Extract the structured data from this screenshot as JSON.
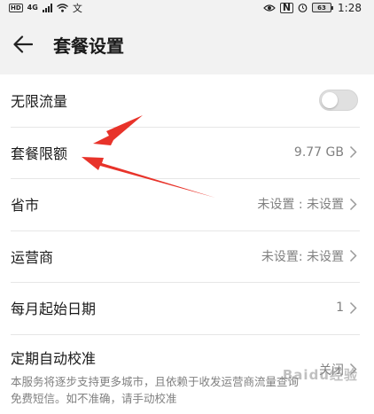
{
  "status_bar": {
    "hd": "HD",
    "network": "4G",
    "wifi_text": "文",
    "nfc": "N",
    "battery": "63",
    "time": "1:28"
  },
  "header": {
    "title": "套餐设置"
  },
  "settings": {
    "unlimited": {
      "label": "无限流量",
      "enabled": false
    },
    "quota": {
      "label": "套餐限额",
      "value": "9.77 GB"
    },
    "province": {
      "label": "省市",
      "value": "未设置 : 未设置"
    },
    "carrier": {
      "label": "运营商",
      "value": "未设置: 未设置"
    },
    "start_day": {
      "label": "每月起始日期",
      "value": "1"
    },
    "auto_calibrate": {
      "label": "定期自动校准",
      "description": "本服务将逐步支持更多城市，且依赖于收发运营商流量查询免费短信。如不准确，请手动校准",
      "value": "关闭"
    }
  },
  "colors": {
    "arrow": "#e8332a",
    "background": "#f2f2f2",
    "card": "#ffffff"
  },
  "watermark": "Baidu经验"
}
